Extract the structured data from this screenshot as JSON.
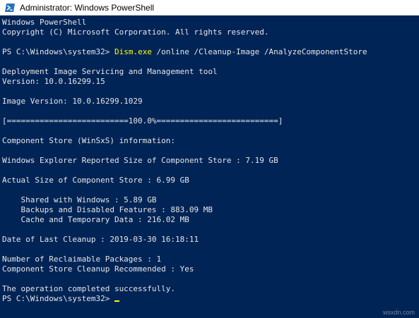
{
  "window": {
    "title": "Administrator: Windows PowerShell",
    "icon": "powershell-icon"
  },
  "colors": {
    "console_background": "#012456",
    "console_text": "#e6e6e6",
    "command_highlight": "#ffff00",
    "titlebar_background": "#ffffff"
  },
  "console": {
    "header_line1": "Windows PowerShell",
    "header_line2": "Copyright (C) Microsoft Corporation. All rights reserved.",
    "prompt": "PS C:\\Windows\\system32> ",
    "command_name": "Dism.exe",
    "command_args": " /online /Cleanup-Image /AnalyzeComponentStore",
    "tool_name": "Deployment Image Servicing and Management tool",
    "tool_version": "Version: 10.0.16299.15",
    "image_version": "Image Version: 10.0.16299.1029",
    "progress_bar": "[==========================100.0%==========================]",
    "store_info_heading": "Component Store (WinSxS) information:",
    "explorer_reported_size": "Windows Explorer Reported Size of Component Store : 7.19 GB",
    "actual_size": "Actual Size of Component Store : 6.99 GB",
    "shared_with_windows": "    Shared with Windows : 5.89 GB",
    "backups_disabled_features": "    Backups and Disabled Features : 883.09 MB",
    "cache_temporary_data": "    Cache and Temporary Data : 216.02 MB",
    "last_cleanup": "Date of Last Cleanup : 2019-03-30 16:18:11",
    "reclaimable_packages": "Number of Reclaimable Packages : 1",
    "cleanup_recommended": "Component Store Cleanup Recommended : Yes",
    "completed_message": "The operation completed successfully.",
    "final_prompt": "PS C:\\Windows\\system32> "
  },
  "watermark": "wsxdn.com"
}
